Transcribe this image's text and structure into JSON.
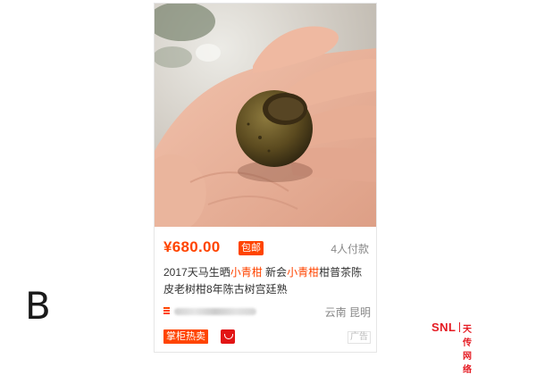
{
  "option_label": "B",
  "product": {
    "image_alt": "hand holding dried small green tangerine pu-erh tea",
    "price": "¥680.00",
    "free_shipping": "包邮",
    "payers": "4人付款",
    "title_segments": [
      "2017天马生晒",
      "小青柑",
      " 新会",
      "小青柑",
      "柑普茶陈皮老树柑8年陈古树宫廷熟"
    ],
    "shop_name_blurred": "",
    "location": "云南 昆明",
    "hot_badge": "掌柜热卖",
    "ad_label": "广告"
  },
  "watermark": {
    "brand": "SNL",
    "chinese": "天传网络"
  },
  "colors": {
    "accent": "#ff4400",
    "watermark": "#e51b23"
  }
}
